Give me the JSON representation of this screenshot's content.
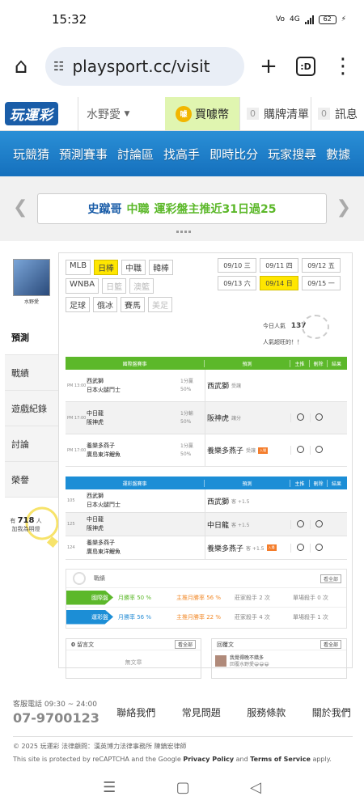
{
  "status": {
    "time": "15:32",
    "battery": "62",
    "net": "4G"
  },
  "browser": {
    "url": "playsport.cc/visit",
    "tab_count": ":D"
  },
  "site": {
    "logo": "玩運彩",
    "user": "水野愛",
    "buy": "買噱幣",
    "coin_icon": "噱",
    "cart_count": "0",
    "cart": "購牌清單",
    "msg_count": "0",
    "msg": "訊息"
  },
  "nav": [
    "玩競猜",
    "預測賽事",
    "討論區",
    "找高手",
    "即時比分",
    "玩家搜尋",
    "數據"
  ],
  "banner": {
    "name": "史蹴哥",
    "hit": "中職",
    "text": "運彩盤主推近31日過25"
  },
  "sidebar": {
    "uname": "水野愛",
    "items": [
      "預測",
      "戰績",
      "遊戲紀錄",
      "討論",
      "榮譽"
    ],
    "count": "718",
    "count_pre": "有",
    "count_suf": "人",
    "count_note": "加我為明燈"
  },
  "sports": [
    [
      "MLB",
      "日棒",
      "中職",
      "韓棒"
    ],
    [
      "WNBA",
      "日籃",
      "澳籃"
    ],
    [
      "足球",
      "俄冰",
      "賽馬",
      "美足"
    ]
  ],
  "dates": [
    {
      "d": "09/10",
      "w": "三"
    },
    {
      "d": "09/11",
      "w": "四"
    },
    {
      "d": "09/12",
      "w": "五"
    },
    {
      "d": "09/13",
      "w": "六"
    },
    {
      "d": "09/14",
      "w": "日"
    },
    {
      "d": "09/15",
      "w": "一"
    }
  ],
  "pop": {
    "label": "今日人氣",
    "value": "137",
    "sub": "人氣超旺的！！"
  },
  "t1": {
    "headers": [
      "國際盤賽事",
      "預測",
      "主推",
      "刪除",
      "結果"
    ],
    "rows": [
      {
        "time": "PM 13:00",
        "team1": "西武獅",
        "team2": "日本火腿鬥士",
        "hc1": "1分贏",
        "hc2": "50%",
        "pick": "西武獅",
        "note": "受讓"
      },
      {
        "time": "PM 17:00",
        "team1": "中日龍",
        "team2": "阪神虎",
        "hc1": "1分輸",
        "hc2": "50%",
        "pick": "阪神虎",
        "note": "讓分"
      },
      {
        "time": "PM 17:00",
        "team1": "養樂多燕子",
        "team2": "廣島東洋鯉魚",
        "hc1": "1分贏",
        "hc2": "50%",
        "pick": "養樂多燕子",
        "note": "受讓"
      }
    ]
  },
  "t2": {
    "headers": [
      "運彩盤賽事",
      "預測",
      "主推",
      "刪除",
      "結果"
    ],
    "rows": [
      {
        "time": "105",
        "team1": "西武獅",
        "team2": "日本火腿鬥士",
        "pick": "西武獅",
        "note": "客 +1.5"
      },
      {
        "time": "125",
        "team1": "中日龍",
        "team2": "阪神虎",
        "pick": "中日龍",
        "note": "客 +1.5"
      },
      {
        "time": "124",
        "team1": "養樂多燕子",
        "team2": "廣島東洋鯉魚",
        "pick": "養樂多燕子",
        "note": "客 +1.5"
      }
    ]
  },
  "stats": {
    "title": "戰績",
    "see_all": "看全部",
    "rows": [
      {
        "tag": "國際盤",
        "a": "月勝率 50 %",
        "b": "主推月勝率 56 %",
        "c": "莊家殺手 2 次",
        "d": "單場殺手 0 次"
      },
      {
        "tag": "運彩盤",
        "a": "月勝率 56 %",
        "b": "主推月勝率 22 %",
        "c": "莊家殺手 4 次",
        "d": "單場殺手 1 次"
      }
    ]
  },
  "boxes": [
    {
      "count": "0",
      "title": "留言文",
      "see_all": "看全部",
      "empty": "無文章"
    },
    {
      "title": "回覆文",
      "see_all": "看全部",
      "item1": "我覺得晚不錯多",
      "item2": "回覆水野愛😀😀😀"
    }
  ],
  "footer": {
    "hotline_label": "客服電話 09:30 ~ 24:00",
    "hotline": "07-9700123",
    "links": [
      "聯絡我們",
      "常見問題",
      "服務條款",
      "關於我們"
    ],
    "copy1": "© 2025 玩運彩 法律顧問：漢英博力法律事務所 陳鎮宏律師",
    "copy2a": "This site is protected by reCAPTCHA and the Google ",
    "pp": "Privacy Policy",
    "and": " and ",
    "tos": "Terms of Service",
    "apply": " apply."
  },
  "colors": {
    "green": "#5cb82a",
    "blue": "#1c8ed6",
    "yellow": "#ffe600",
    "orange": "#f28a2a"
  }
}
